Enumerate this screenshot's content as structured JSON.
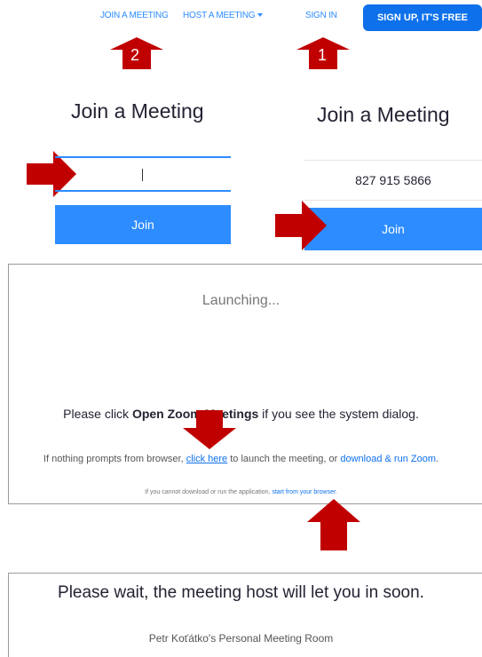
{
  "nav": {
    "join_meeting": "JOIN A MEETING",
    "host_meeting": "HOST A MEETING",
    "sign_in": "SIGN IN",
    "sign_up": "SIGN UP, IT'S FREE"
  },
  "annotations": {
    "step1": "1",
    "step2": "2",
    "arrow_color": "#c00000"
  },
  "left_panel": {
    "title": "Join a Meeting",
    "input_value": "",
    "join_label": "Join"
  },
  "right_panel": {
    "title": "Join a Meeting",
    "meeting_id": "827 915 5866",
    "join_label": "Join"
  },
  "launch": {
    "status": "Launching...",
    "instruction_prefix": "Please click ",
    "instruction_bold": "Open Zoom Meetings",
    "instruction_suffix": " if you see the system dialog.",
    "nothing_prefix": "If nothing prompts from browser, ",
    "click_here": "click here",
    "nothing_middle": " to launch the meeting, or ",
    "download_run": "download & run Zoom",
    "nothing_suffix": ".",
    "cannot_prefix": "If you cannot download or run the application, ",
    "start_browser": "start from your browser",
    "cannot_suffix": "."
  },
  "waiting": {
    "title": "Please wait, the meeting host will let you in soon.",
    "room": "Petr Koťátko's Personal Meeting Room"
  },
  "colors": {
    "zoom_blue": "#2d8cff",
    "signup_blue": "#0e71eb",
    "arrow_red": "#c00000"
  }
}
